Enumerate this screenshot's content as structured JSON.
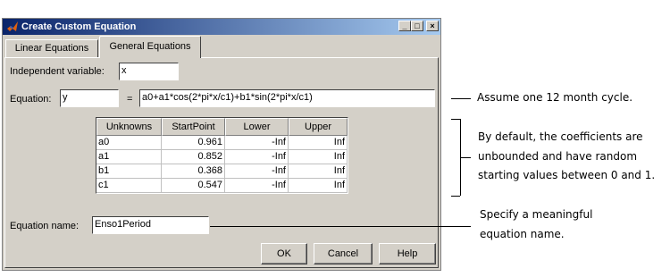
{
  "window": {
    "title": "Create Custom Equation",
    "minimize": "_",
    "maximize": "□",
    "close": "×"
  },
  "tabs": [
    {
      "label": "Linear Equations",
      "selected": false
    },
    {
      "label": "General Equations",
      "selected": true
    }
  ],
  "form": {
    "independent_variable_label": "Independent variable:",
    "independent_variable_value": "x",
    "equation_label": "Equation:",
    "equation_lhs": "y",
    "equals": "=",
    "equation_rhs": "a0+a1*cos(2*pi*x/c1)+b1*sin(2*pi*x/c1)",
    "equation_name_label": "Equation name:",
    "equation_name_value": "Enso1Period"
  },
  "table": {
    "headers": [
      "Unknowns",
      "StartPoint",
      "Lower",
      "Upper"
    ],
    "rows": [
      [
        "a0",
        "0.961",
        "-Inf",
        "Inf"
      ],
      [
        "a1",
        "0.852",
        "-Inf",
        "Inf"
      ],
      [
        "b1",
        "0.368",
        "-Inf",
        "Inf"
      ],
      [
        "c1",
        "0.547",
        "-Inf",
        "Inf"
      ]
    ]
  },
  "buttons": {
    "ok": "OK",
    "cancel": "Cancel",
    "help": "Help"
  },
  "annotations": {
    "cycle": "Assume one 12 month cycle.",
    "coefficients": [
      "By default, the coefficients are",
      "unbounded and have random",
      "starting values between 0 and 1."
    ],
    "name": [
      "Specify a meaningful",
      "equation name."
    ]
  },
  "colors": {
    "titlebar_start": "#0a246a",
    "titlebar_end": "#a6caf0",
    "dialog_face": "#d4d0c8"
  }
}
